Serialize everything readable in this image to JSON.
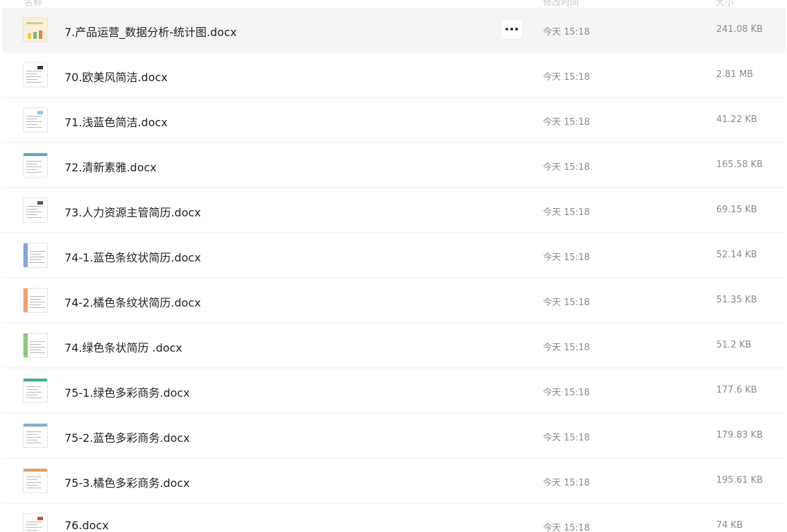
{
  "header": {
    "name": "名称",
    "modified": "修改时间",
    "size": "大小"
  },
  "files": [
    {
      "name": "7.产品运营_数据分析-统计图.docx",
      "modified": "今天 15:18",
      "size": "241.08 KB",
      "hovered": true,
      "accent": "#e9c84a",
      "thumb_style": "chart"
    },
    {
      "name": "70.欧美风简洁.docx",
      "modified": "今天 15:18",
      "size": "2.81 MB",
      "accent": "#3a3a3a",
      "thumb_style": "plain"
    },
    {
      "name": "71.浅蓝色简洁.docx",
      "modified": "今天 15:18",
      "size": "41.22 KB",
      "accent": "#9cc4e0",
      "thumb_style": "plain"
    },
    {
      "name": "72.清新素雅.docx",
      "modified": "今天 15:18",
      "size": "165.58 KB",
      "accent": "#5aa9b5",
      "thumb_style": "topbar"
    },
    {
      "name": "73.人力资源主管简历.docx",
      "modified": "今天 15:18",
      "size": "69.15 KB",
      "accent": "#555555",
      "thumb_style": "plain"
    },
    {
      "name": "74-1.蓝色条纹状简历.docx",
      "modified": "今天 15:18",
      "size": "52.14 KB",
      "accent": "#7fa7d8",
      "thumb_style": "sidebar"
    },
    {
      "name": "74-2.橘色条纹状简历.docx",
      "modified": "今天 15:18",
      "size": "51.35 KB",
      "accent": "#f0a070",
      "thumb_style": "sidebar"
    },
    {
      "name": "74.绿色条状简历 .docx",
      "modified": "今天 15:18",
      "size": "51.2 KB",
      "accent": "#8cc87a",
      "thumb_style": "sidebar"
    },
    {
      "name": "75-1.绿色多彩商务.docx",
      "modified": "今天 15:18",
      "size": "177.6 KB",
      "accent": "#3bb48a",
      "thumb_style": "topbar"
    },
    {
      "name": "75-2.蓝色多彩商务.docx",
      "modified": "今天 15:18",
      "size": "179.83 KB",
      "accent": "#7fb0d8",
      "thumb_style": "topbar"
    },
    {
      "name": "75-3.橘色多彩商务.docx",
      "modified": "今天 15:18",
      "size": "195.61 KB",
      "accent": "#f09a5a",
      "thumb_style": "topbar"
    },
    {
      "name": "76.docx",
      "modified": "今天 15:18",
      "size": "74 KB",
      "accent": "#d05050",
      "thumb_style": "plain"
    }
  ]
}
